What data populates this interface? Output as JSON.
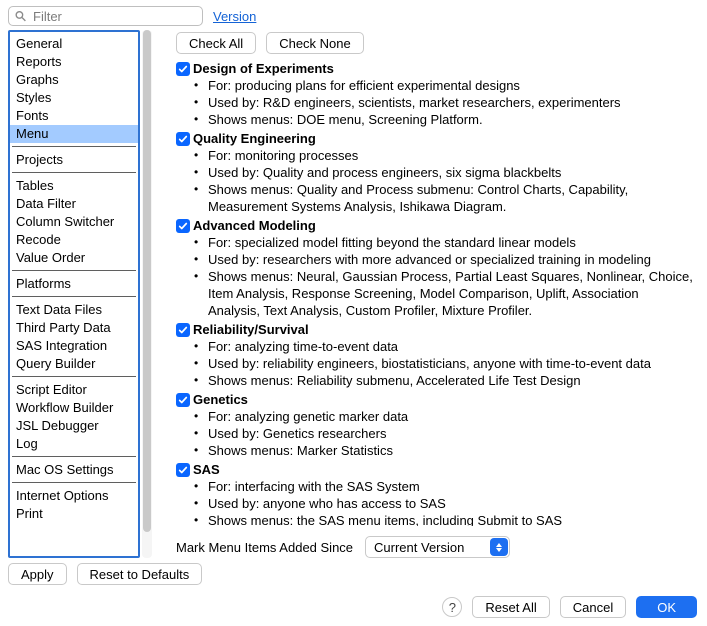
{
  "search": {
    "placeholder": "Filter"
  },
  "version_link": "Version",
  "sidebar": {
    "groups": [
      [
        "General",
        "Reports",
        "Graphs",
        "Styles",
        "Fonts",
        "Menu"
      ],
      [
        "Projects"
      ],
      [
        "Tables",
        "Data Filter",
        "Column Switcher",
        "Recode",
        "Value Order"
      ],
      [
        "Platforms"
      ],
      [
        "Text Data Files",
        "Third Party Data",
        "SAS Integration",
        "Query Builder"
      ],
      [
        "Script Editor",
        "Workflow Builder",
        "JSL Debugger",
        "Log"
      ],
      [
        "Mac OS Settings"
      ],
      [
        "Internet Options",
        "Print"
      ]
    ],
    "selected": "Menu"
  },
  "buttons": {
    "check_all": "Check All",
    "check_none": "Check None",
    "apply": "Apply",
    "reset_defaults": "Reset to Defaults",
    "reset_all": "Reset All",
    "cancel": "Cancel",
    "ok": "OK",
    "help": "?"
  },
  "categories": [
    {
      "title": "Design of Experiments",
      "checked": true,
      "bullets": [
        "For: producing plans for efficient experimental designs",
        "Used by: R&D engineers, scientists, market researchers, experimenters",
        "Shows menus: DOE menu, Screening Platform."
      ]
    },
    {
      "title": "Quality Engineering",
      "checked": true,
      "bullets": [
        "For: monitoring processes",
        "Used by: Quality and process engineers, six sigma blackbelts",
        "Shows menus: Quality and Process submenu: Control Charts, Capability, Measurement Systems Analysis, Ishikawa Diagram."
      ]
    },
    {
      "title": "Advanced Modeling",
      "checked": true,
      "bullets": [
        "For: specialized model fitting beyond the standard linear models",
        "Used by: researchers with more advanced or specialized training in modeling",
        "Shows menus: Neural, Gaussian Process, Partial Least Squares, Nonlinear, Choice, Item Analysis, Response Screening, Model Comparison, Uplift, Association Analysis, Text Analysis, Custom Profiler, Mixture Profiler."
      ]
    },
    {
      "title": "Reliability/Survival",
      "checked": true,
      "bullets": [
        "For: analyzing time-to-event data",
        "Used by: reliability engineers, biostatisticians, anyone with time-to-event data",
        "Shows menus: Reliability submenu, Accelerated Life Test Design"
      ]
    },
    {
      "title": "Genetics",
      "checked": true,
      "bullets": [
        "For: analyzing genetic marker data",
        "Used by: Genetics researchers",
        "Shows menus: Marker Statistics"
      ]
    },
    {
      "title": "SAS",
      "checked": true,
      "bullets": [
        "For: interfacing with the SAS System",
        "Used by: anyone who has access to SAS",
        "Shows menus: the SAS menu items, including Submit to SAS"
      ]
    }
  ],
  "mark": {
    "label": "Mark Menu Items Added Since",
    "selected": "Current Version"
  }
}
